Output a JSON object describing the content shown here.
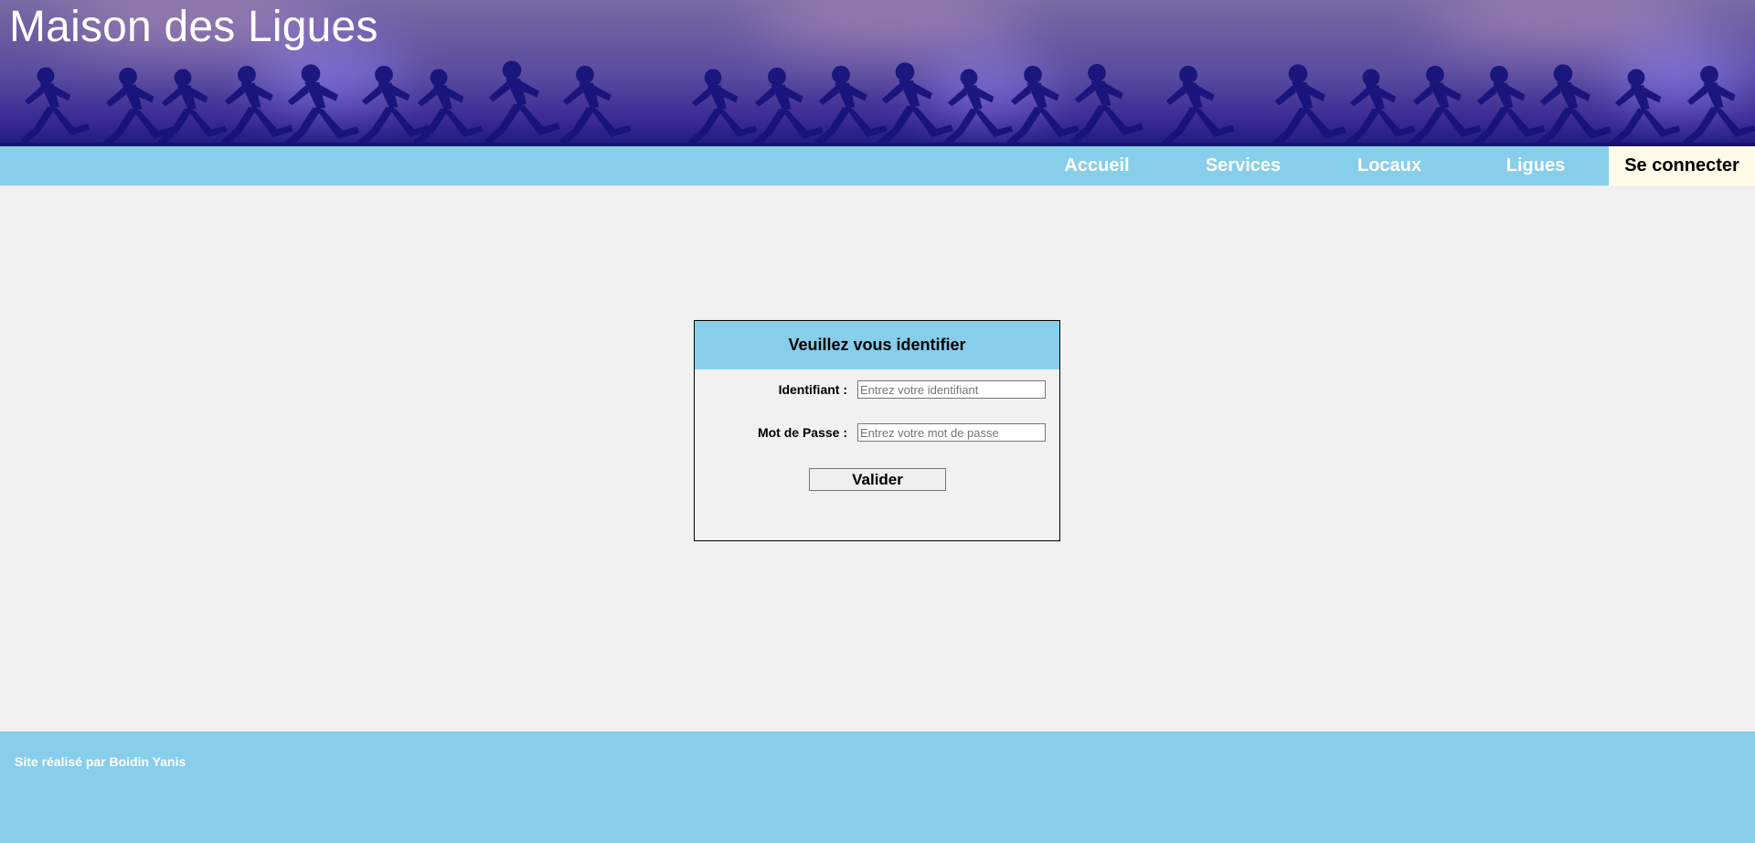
{
  "banner": {
    "title": "Maison des Ligues"
  },
  "nav": {
    "items": [
      {
        "label": "Accueil"
      },
      {
        "label": "Services"
      },
      {
        "label": "Locaux"
      },
      {
        "label": "Ligues"
      },
      {
        "label": "Se connecter",
        "active": true
      }
    ]
  },
  "login": {
    "heading": "Veuillez vous identifier",
    "identifiant_label": "Identifiant :",
    "identifiant_value": "",
    "identifiant_placeholder": "Entrez votre identifiant",
    "password_label": "Mot de Passe :",
    "password_value": "",
    "password_placeholder": "Entrez votre mot de passe",
    "submit_label": "Valider"
  },
  "footer": {
    "credit": "Site réalisé par Boidin Yanis"
  },
  "colors": {
    "accent": "#87ceeb",
    "active_tab_bg": "#fffbe8",
    "page_bg": "#f1f1f1",
    "banner_dark": "#1e1a80",
    "runner_silhouette": "#16127a"
  }
}
